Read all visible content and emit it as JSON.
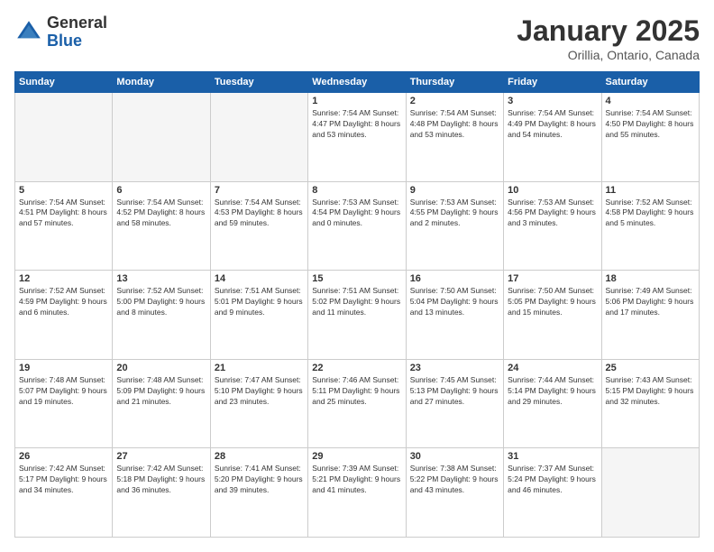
{
  "logo": {
    "general": "General",
    "blue": "Blue"
  },
  "header": {
    "month": "January 2025",
    "location": "Orillia, Ontario, Canada"
  },
  "weekdays": [
    "Sunday",
    "Monday",
    "Tuesday",
    "Wednesday",
    "Thursday",
    "Friday",
    "Saturday"
  ],
  "weeks": [
    [
      {
        "day": "",
        "text": ""
      },
      {
        "day": "",
        "text": ""
      },
      {
        "day": "",
        "text": ""
      },
      {
        "day": "1",
        "text": "Sunrise: 7:54 AM\nSunset: 4:47 PM\nDaylight: 8 hours\nand 53 minutes."
      },
      {
        "day": "2",
        "text": "Sunrise: 7:54 AM\nSunset: 4:48 PM\nDaylight: 8 hours\nand 53 minutes."
      },
      {
        "day": "3",
        "text": "Sunrise: 7:54 AM\nSunset: 4:49 PM\nDaylight: 8 hours\nand 54 minutes."
      },
      {
        "day": "4",
        "text": "Sunrise: 7:54 AM\nSunset: 4:50 PM\nDaylight: 8 hours\nand 55 minutes."
      }
    ],
    [
      {
        "day": "5",
        "text": "Sunrise: 7:54 AM\nSunset: 4:51 PM\nDaylight: 8 hours\nand 57 minutes."
      },
      {
        "day": "6",
        "text": "Sunrise: 7:54 AM\nSunset: 4:52 PM\nDaylight: 8 hours\nand 58 minutes."
      },
      {
        "day": "7",
        "text": "Sunrise: 7:54 AM\nSunset: 4:53 PM\nDaylight: 8 hours\nand 59 minutes."
      },
      {
        "day": "8",
        "text": "Sunrise: 7:53 AM\nSunset: 4:54 PM\nDaylight: 9 hours\nand 0 minutes."
      },
      {
        "day": "9",
        "text": "Sunrise: 7:53 AM\nSunset: 4:55 PM\nDaylight: 9 hours\nand 2 minutes."
      },
      {
        "day": "10",
        "text": "Sunrise: 7:53 AM\nSunset: 4:56 PM\nDaylight: 9 hours\nand 3 minutes."
      },
      {
        "day": "11",
        "text": "Sunrise: 7:52 AM\nSunset: 4:58 PM\nDaylight: 9 hours\nand 5 minutes."
      }
    ],
    [
      {
        "day": "12",
        "text": "Sunrise: 7:52 AM\nSunset: 4:59 PM\nDaylight: 9 hours\nand 6 minutes."
      },
      {
        "day": "13",
        "text": "Sunrise: 7:52 AM\nSunset: 5:00 PM\nDaylight: 9 hours\nand 8 minutes."
      },
      {
        "day": "14",
        "text": "Sunrise: 7:51 AM\nSunset: 5:01 PM\nDaylight: 9 hours\nand 9 minutes."
      },
      {
        "day": "15",
        "text": "Sunrise: 7:51 AM\nSunset: 5:02 PM\nDaylight: 9 hours\nand 11 minutes."
      },
      {
        "day": "16",
        "text": "Sunrise: 7:50 AM\nSunset: 5:04 PM\nDaylight: 9 hours\nand 13 minutes."
      },
      {
        "day": "17",
        "text": "Sunrise: 7:50 AM\nSunset: 5:05 PM\nDaylight: 9 hours\nand 15 minutes."
      },
      {
        "day": "18",
        "text": "Sunrise: 7:49 AM\nSunset: 5:06 PM\nDaylight: 9 hours\nand 17 minutes."
      }
    ],
    [
      {
        "day": "19",
        "text": "Sunrise: 7:48 AM\nSunset: 5:07 PM\nDaylight: 9 hours\nand 19 minutes."
      },
      {
        "day": "20",
        "text": "Sunrise: 7:48 AM\nSunset: 5:09 PM\nDaylight: 9 hours\nand 21 minutes."
      },
      {
        "day": "21",
        "text": "Sunrise: 7:47 AM\nSunset: 5:10 PM\nDaylight: 9 hours\nand 23 minutes."
      },
      {
        "day": "22",
        "text": "Sunrise: 7:46 AM\nSunset: 5:11 PM\nDaylight: 9 hours\nand 25 minutes."
      },
      {
        "day": "23",
        "text": "Sunrise: 7:45 AM\nSunset: 5:13 PM\nDaylight: 9 hours\nand 27 minutes."
      },
      {
        "day": "24",
        "text": "Sunrise: 7:44 AM\nSunset: 5:14 PM\nDaylight: 9 hours\nand 29 minutes."
      },
      {
        "day": "25",
        "text": "Sunrise: 7:43 AM\nSunset: 5:15 PM\nDaylight: 9 hours\nand 32 minutes."
      }
    ],
    [
      {
        "day": "26",
        "text": "Sunrise: 7:42 AM\nSunset: 5:17 PM\nDaylight: 9 hours\nand 34 minutes."
      },
      {
        "day": "27",
        "text": "Sunrise: 7:42 AM\nSunset: 5:18 PM\nDaylight: 9 hours\nand 36 minutes."
      },
      {
        "day": "28",
        "text": "Sunrise: 7:41 AM\nSunset: 5:20 PM\nDaylight: 9 hours\nand 39 minutes."
      },
      {
        "day": "29",
        "text": "Sunrise: 7:39 AM\nSunset: 5:21 PM\nDaylight: 9 hours\nand 41 minutes."
      },
      {
        "day": "30",
        "text": "Sunrise: 7:38 AM\nSunset: 5:22 PM\nDaylight: 9 hours\nand 43 minutes."
      },
      {
        "day": "31",
        "text": "Sunrise: 7:37 AM\nSunset: 5:24 PM\nDaylight: 9 hours\nand 46 minutes."
      },
      {
        "day": "",
        "text": ""
      }
    ]
  ]
}
